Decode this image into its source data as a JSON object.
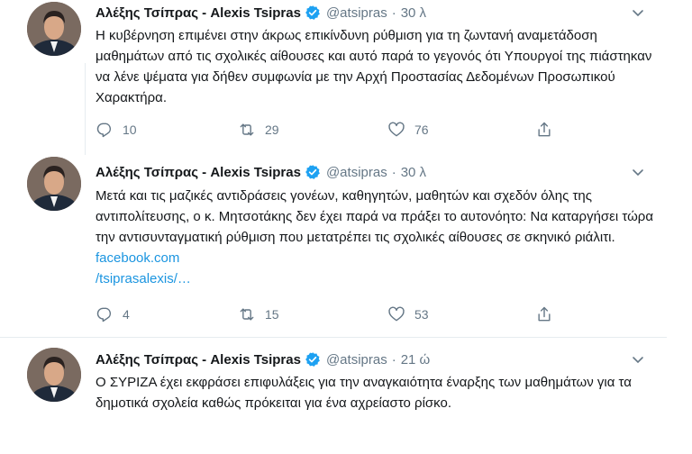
{
  "colors": {
    "text": "#14171a",
    "muted": "#657786",
    "link": "#1b95e0",
    "verified": "#1da1f2",
    "divider": "#e6ecf0"
  },
  "tweets": [
    {
      "name": "Αλέξης Τσίπρας - Alexis Tsipras",
      "handle": "@atsipras",
      "separator": "·",
      "time": "30 λ",
      "text": "Η κυβέρνηση επιμένει στην άκρως επικίνδυνη ρύθμιση για τη ζωντανή αναμετάδοση μαθημάτων από τις σχολικές αίθουσες και αυτό παρά το γεγονός ότι Υπουργοί της πιάστηκαν να λένε ψέματα για δήθεν συμφωνία με την Αρχή Προστασίας Δεδομένων Προσωπικού Χαρακτήρα.",
      "replies": "10",
      "retweets": "29",
      "likes": "76"
    },
    {
      "name": "Αλέξης Τσίπρας - Alexis Tsipras",
      "handle": "@atsipras",
      "separator": "·",
      "time": "30 λ",
      "text": "Μετά και τις μαζικές αντιδράσεις γονέων, καθηγητών, μαθητών και σχεδόν όλης της αντιπολίτευσης, ο κ. Μητσοτάκης δεν έχει παρά να πράξει το αυτονόητο: Να καταργήσει τώρα την αντισυνταγματική ρύθμιση που μετατρέπει τις σχολικές αίθουσες σε σκηνικό ριάλιτι.",
      "link_line1": "facebook.com",
      "link_line2": "/tsiprasalexis/…",
      "replies": "4",
      "retweets": "15",
      "likes": "53"
    },
    {
      "name": "Αλέξης Τσίπρας - Alexis Tsipras",
      "handle": "@atsipras",
      "separator": "·",
      "time": "21 ώ",
      "text": "Ο ΣΥΡΙΖΑ έχει εκφράσει επιφυλάξεις για την αναγκαιότητα έναρξης των μαθημάτων για τα δημοτικά σχολεία καθώς πρόκειται για ένα αχρείαστο ρίσκο."
    }
  ]
}
